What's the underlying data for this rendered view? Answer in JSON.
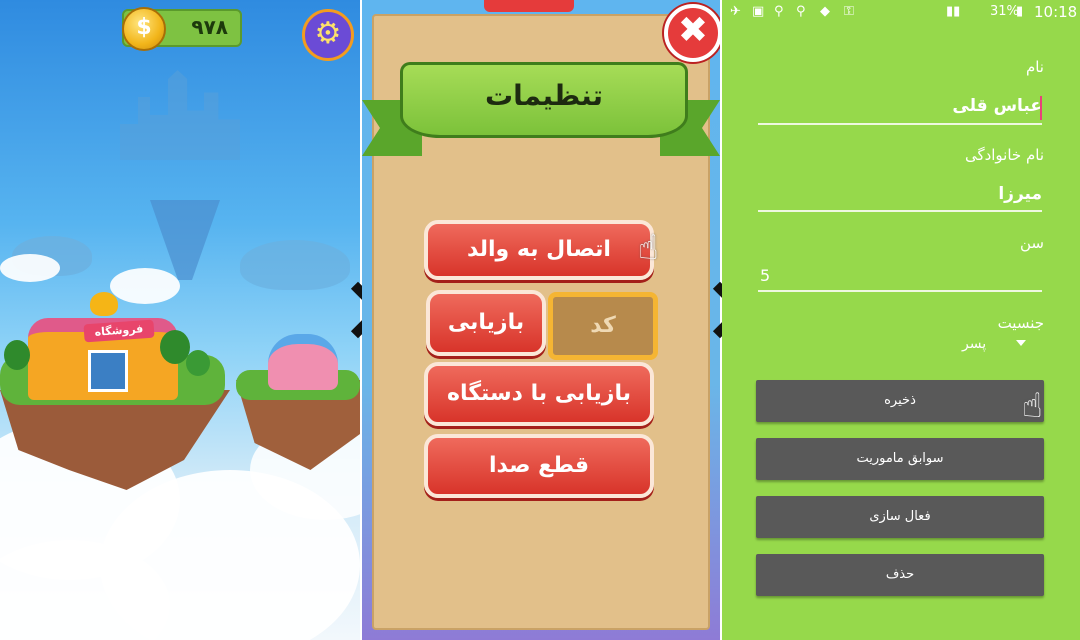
{
  "game_screen": {
    "coin_count": "۹۷۸",
    "coin_symbol": "$",
    "shop_sign": "فروشگاه",
    "icons": [
      "coin-icon",
      "gear-icon"
    ]
  },
  "settings_screen": {
    "title": "تنظیمات",
    "close_symbol": "✖",
    "buttons": {
      "connect_parent": "اتصال به والد",
      "recover": "بازیابی",
      "code": "کد",
      "recover_with_device": "بازیابی با دستگاه",
      "mute": "قطع صدا"
    }
  },
  "profile_form": {
    "status_bar": {
      "battery": "31%",
      "time": "10:18"
    },
    "fields": {
      "first_name_label": "نام",
      "first_name_value": "عباس قلی",
      "last_name_label": "نام خانوادگی",
      "last_name_value": "میرزا",
      "age_label": "سن",
      "age_value": "5",
      "gender_label": "جنسیت",
      "gender_value": "پسر"
    },
    "buttons": {
      "save": "ذخیره",
      "mission_history": "سوابق ماموریت",
      "activation": "فعال سازی",
      "delete": "حذف"
    }
  },
  "colors": {
    "form_bg": "#96d94b",
    "button_gray": "#595959",
    "game_red": "#d8342a",
    "ribbon_green": "#7cc23a"
  }
}
